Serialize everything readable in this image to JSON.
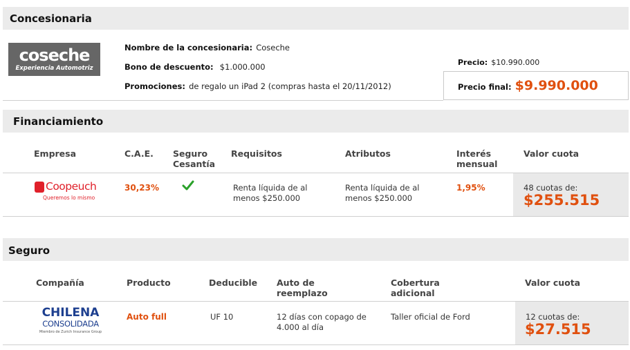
{
  "concesionaria": {
    "section_title": "Concesionaria",
    "logo": {
      "text": "coseche",
      "tagline": "Experiencia Automotriz"
    },
    "nombre_label": "Nombre de la concesionaria:",
    "nombre_value": "Coseche",
    "bono_label": "Bono de descuento:",
    "bono_value": "$1.000.000",
    "promo_label": "Promociones:",
    "promo_value": "de regalo un iPad 2 (compras hasta el 20/11/2012)",
    "precio_label": "Precio:",
    "precio_value": "$10.990.000",
    "precio_final_label": "Precio final:",
    "precio_final_value": "$9.990.000"
  },
  "financiamiento": {
    "section_title": "Financiamiento",
    "headers": [
      "Empresa",
      "C.A.E.",
      "Seguro Cesantía",
      "Requisitos",
      "Atributos",
      "Interés mensual",
      "Valor cuota"
    ],
    "row": {
      "logo_text": "Coopeuch",
      "logo_tagline": "Queremos lo mismo",
      "cae": "30,23%",
      "seguro_cesantia_icon": "check-icon",
      "requisitos": "Renta líquida de al menos $250.000",
      "atributos": "Renta líquida de al menos $250.000",
      "interes": "1,95%",
      "cuotas_label": "48 cuotas de:",
      "cuota_value": "$255.515"
    }
  },
  "seguro": {
    "section_title": "Seguro",
    "headers": [
      "Compañía",
      "Producto",
      "Deducible",
      "Auto de reemplazo",
      "Cobertura adicional",
      "Valor cuota"
    ],
    "row": {
      "logo_line1": "CHILENA",
      "logo_line2": "CONSOLIDADA",
      "logo_tagline": "Miembro de Zurich Insurance Group",
      "producto": "Auto full",
      "deducible": "UF 10",
      "auto_reemplazo": "12 días con copago de 4.000 al día",
      "cobertura": "Taller oficial de Ford",
      "cuotas_label": "12 cuotas de:",
      "cuota_value": "$27.515"
    }
  },
  "colors": {
    "accent": "#e0500f",
    "band": "#ebebeb",
    "check": "#2aa12a",
    "logo_gray": "#666666",
    "chilena_blue": "#1d3f8f",
    "coopeuch_red": "#e0202a"
  }
}
